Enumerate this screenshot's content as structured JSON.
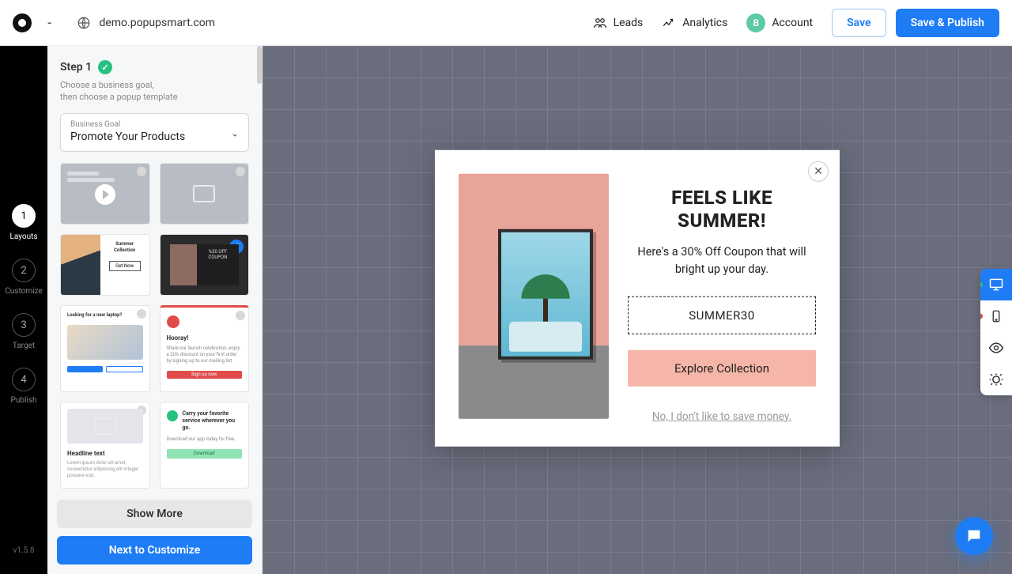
{
  "topbar": {
    "campaign_name": "-",
    "domain": "demo.popupsmart.com",
    "leads": "Leads",
    "analytics": "Analytics",
    "account_initial": "B",
    "account_label": "Account",
    "save": "Save",
    "publish": "Save & Publish"
  },
  "steps": {
    "items": [
      {
        "num": "1",
        "label": "Layouts",
        "active": true
      },
      {
        "num": "2",
        "label": "Customize",
        "active": false
      },
      {
        "num": "3",
        "label": "Target",
        "active": false
      },
      {
        "num": "4",
        "label": "Publish",
        "active": false
      }
    ],
    "version": "v1.5.8"
  },
  "panel": {
    "step_title": "Step 1",
    "hint_line1": "Choose a business goal,",
    "hint_line2": "then choose a popup template",
    "goal_label": "Business Goal",
    "goal_value": "Promote Your Products",
    "show_more": "Show More",
    "next": "Next to Customize",
    "templates": {
      "t3_title": "Summer Collection",
      "t3_btn": "Get Now",
      "t4_caption": "%30 OFF COUPON",
      "t5_head": "Looking for a new laptop?",
      "t6_head": "Hooray!",
      "t6_body": "Share our launch celebration, enjoy a 20% discount on your first order by signing up to our mailing list.",
      "t6_btn": "Sign up now",
      "t7_head": "Headline text",
      "t7_body": "Lorem ipsum dolor sit amet, consectetur adipiscing elit integer posuere erat.",
      "t8_head": "Carry your favorite service wherever you go.",
      "t8_sub": "Download our app today for free.",
      "t8_btn": "Download"
    }
  },
  "popup": {
    "title_l1": "FEELS LIKE",
    "title_l2": "SUMMER!",
    "subtitle": "Here's a 30% Off Coupon that will bright up your day.",
    "coupon": "SUMMER30",
    "cta": "Explore Collection",
    "decline": "No, I don't like to save money."
  }
}
